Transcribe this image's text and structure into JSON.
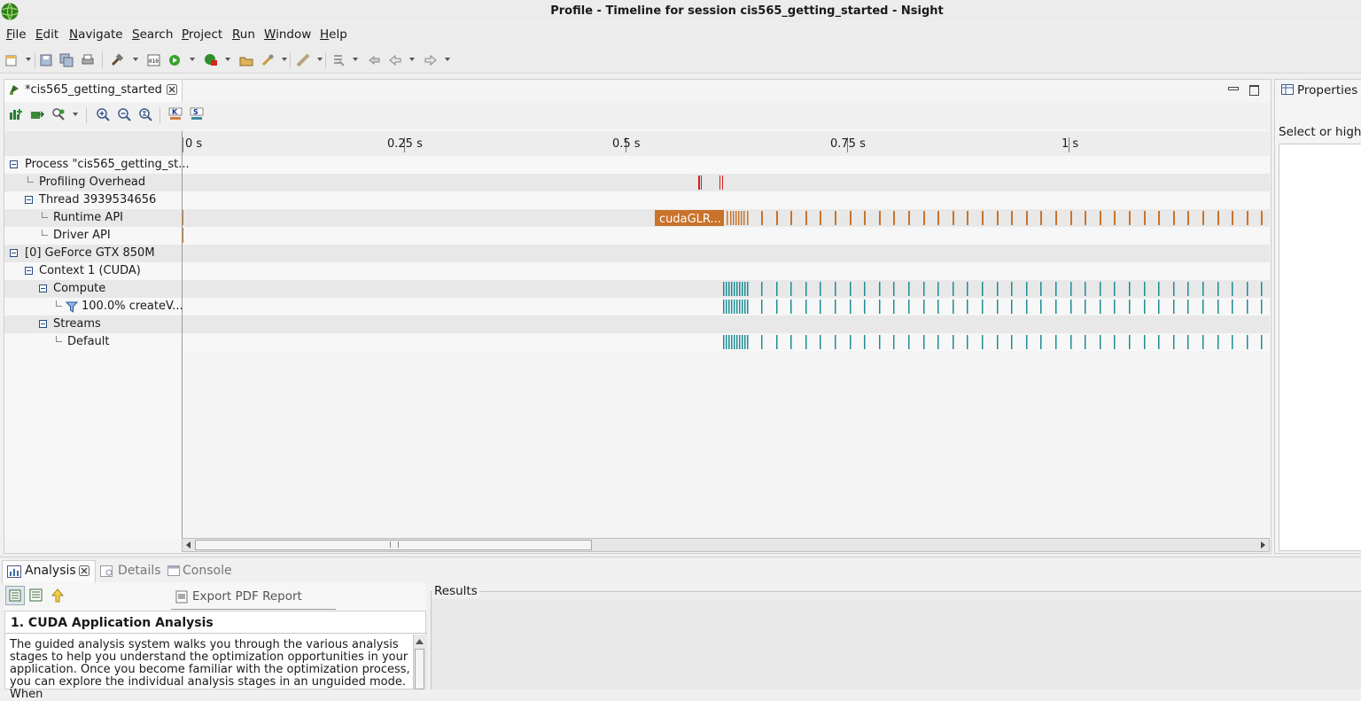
{
  "window": {
    "title": "Profile - Timeline for session cis565_getting_started - Nsight",
    "app_icon": "nsight-globe-icon"
  },
  "menu": [
    {
      "label": "File"
    },
    {
      "label": "Edit"
    },
    {
      "label": "Navigate"
    },
    {
      "label": "Search"
    },
    {
      "label": "Project"
    },
    {
      "label": "Run"
    },
    {
      "label": "Window"
    },
    {
      "label": "Help"
    }
  ],
  "toolbar_icons": [
    "new-icon",
    "save-icon",
    "save-all-icon",
    "print-icon",
    "build-icon",
    "binary-icon",
    "debug-icon",
    "profile-icon",
    "open-icon",
    "tools-icon",
    "annotate-icon",
    "next-annotation-icon",
    "last-edit-icon",
    "back-icon",
    "forward-icon"
  ],
  "editor": {
    "tab_label": "*cis565_getting_started",
    "timeline_toolbar_icons": [
      "add-metrics-icon",
      "export-icon",
      "search-filter-icon",
      "zoom-in-icon",
      "zoom-out-icon",
      "zoom-fit-icon",
      "kernel-icon",
      "stream-icon"
    ],
    "ruler": {
      "unit": "s",
      "ticks": [
        "0 s",
        "0.25 s",
        "0.5 s",
        "0.75 s",
        "1 s"
      ]
    },
    "rows": [
      {
        "label": "Process \"cis565_getting_st...",
        "kind": "expander"
      },
      {
        "label": "Profiling Overhead",
        "kind": "leaf"
      },
      {
        "label": "Thread 3939534656",
        "kind": "expander"
      },
      {
        "label": "Runtime API",
        "kind": "leaf"
      },
      {
        "label": "Driver API",
        "kind": "leaf"
      },
      {
        "label": "[0] GeForce GTX 850M",
        "kind": "expander"
      },
      {
        "label": "Context 1 (CUDA)",
        "kind": "expander"
      },
      {
        "label": "Compute",
        "kind": "expander"
      },
      {
        "label": "100.0% createV...",
        "kind": "leaf-filter"
      },
      {
        "label": "Streams",
        "kind": "expander"
      },
      {
        "label": "Default",
        "kind": "leaf"
      }
    ],
    "runtime_api_block_label": "cudaGLR...",
    "colors": {
      "api": "#c8722a",
      "overhead": "#d41d1d",
      "kernel": "#1c8c96"
    }
  },
  "properties": {
    "title": "Properties",
    "hint": "Select or highlight"
  },
  "bottom": {
    "tabs": [
      {
        "label": "Analysis"
      },
      {
        "label": "Details"
      },
      {
        "label": "Console"
      }
    ],
    "export_label": "Export PDF Report",
    "section_title": "1. CUDA Application Analysis",
    "guide_text": "The guided analysis system walks you through the various analysis stages to help you understand the optimization opportunities in your application. Once you become familiar with the optimization process, you can explore the individual analysis stages in an unguided mode. When",
    "results_label": "Results"
  }
}
